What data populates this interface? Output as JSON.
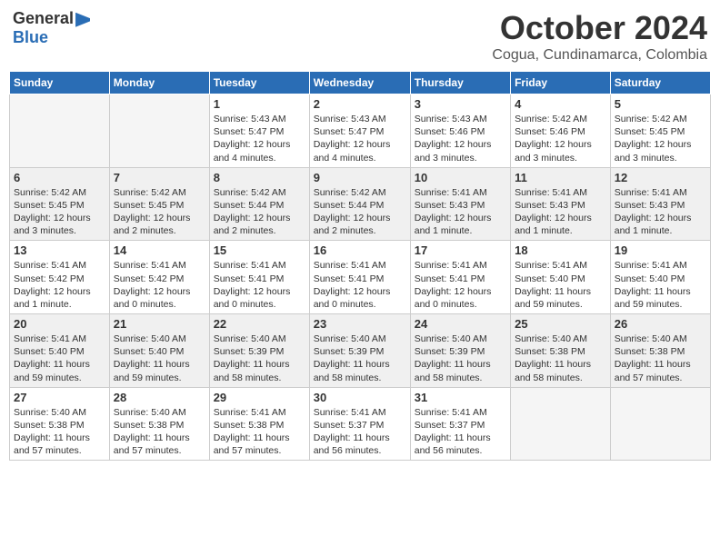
{
  "logo": {
    "general": "General",
    "blue": "Blue"
  },
  "title": "October 2024",
  "location": "Cogua, Cundinamarca, Colombia",
  "weekdays": [
    "Sunday",
    "Monday",
    "Tuesday",
    "Wednesday",
    "Thursday",
    "Friday",
    "Saturday"
  ],
  "weeks": [
    [
      {
        "day": "",
        "info": ""
      },
      {
        "day": "",
        "info": ""
      },
      {
        "day": "1",
        "info": "Sunrise: 5:43 AM\nSunset: 5:47 PM\nDaylight: 12 hours and 4 minutes."
      },
      {
        "day": "2",
        "info": "Sunrise: 5:43 AM\nSunset: 5:47 PM\nDaylight: 12 hours and 4 minutes."
      },
      {
        "day": "3",
        "info": "Sunrise: 5:43 AM\nSunset: 5:46 PM\nDaylight: 12 hours and 3 minutes."
      },
      {
        "day": "4",
        "info": "Sunrise: 5:42 AM\nSunset: 5:46 PM\nDaylight: 12 hours and 3 minutes."
      },
      {
        "day": "5",
        "info": "Sunrise: 5:42 AM\nSunset: 5:45 PM\nDaylight: 12 hours and 3 minutes."
      }
    ],
    [
      {
        "day": "6",
        "info": "Sunrise: 5:42 AM\nSunset: 5:45 PM\nDaylight: 12 hours and 3 minutes."
      },
      {
        "day": "7",
        "info": "Sunrise: 5:42 AM\nSunset: 5:45 PM\nDaylight: 12 hours and 2 minutes."
      },
      {
        "day": "8",
        "info": "Sunrise: 5:42 AM\nSunset: 5:44 PM\nDaylight: 12 hours and 2 minutes."
      },
      {
        "day": "9",
        "info": "Sunrise: 5:42 AM\nSunset: 5:44 PM\nDaylight: 12 hours and 2 minutes."
      },
      {
        "day": "10",
        "info": "Sunrise: 5:41 AM\nSunset: 5:43 PM\nDaylight: 12 hours and 1 minute."
      },
      {
        "day": "11",
        "info": "Sunrise: 5:41 AM\nSunset: 5:43 PM\nDaylight: 12 hours and 1 minute."
      },
      {
        "day": "12",
        "info": "Sunrise: 5:41 AM\nSunset: 5:43 PM\nDaylight: 12 hours and 1 minute."
      }
    ],
    [
      {
        "day": "13",
        "info": "Sunrise: 5:41 AM\nSunset: 5:42 PM\nDaylight: 12 hours and 1 minute."
      },
      {
        "day": "14",
        "info": "Sunrise: 5:41 AM\nSunset: 5:42 PM\nDaylight: 12 hours and 0 minutes."
      },
      {
        "day": "15",
        "info": "Sunrise: 5:41 AM\nSunset: 5:41 PM\nDaylight: 12 hours and 0 minutes."
      },
      {
        "day": "16",
        "info": "Sunrise: 5:41 AM\nSunset: 5:41 PM\nDaylight: 12 hours and 0 minutes."
      },
      {
        "day": "17",
        "info": "Sunrise: 5:41 AM\nSunset: 5:41 PM\nDaylight: 12 hours and 0 minutes."
      },
      {
        "day": "18",
        "info": "Sunrise: 5:41 AM\nSunset: 5:40 PM\nDaylight: 11 hours and 59 minutes."
      },
      {
        "day": "19",
        "info": "Sunrise: 5:41 AM\nSunset: 5:40 PM\nDaylight: 11 hours and 59 minutes."
      }
    ],
    [
      {
        "day": "20",
        "info": "Sunrise: 5:41 AM\nSunset: 5:40 PM\nDaylight: 11 hours and 59 minutes."
      },
      {
        "day": "21",
        "info": "Sunrise: 5:40 AM\nSunset: 5:40 PM\nDaylight: 11 hours and 59 minutes."
      },
      {
        "day": "22",
        "info": "Sunrise: 5:40 AM\nSunset: 5:39 PM\nDaylight: 11 hours and 58 minutes."
      },
      {
        "day": "23",
        "info": "Sunrise: 5:40 AM\nSunset: 5:39 PM\nDaylight: 11 hours and 58 minutes."
      },
      {
        "day": "24",
        "info": "Sunrise: 5:40 AM\nSunset: 5:39 PM\nDaylight: 11 hours and 58 minutes."
      },
      {
        "day": "25",
        "info": "Sunrise: 5:40 AM\nSunset: 5:38 PM\nDaylight: 11 hours and 58 minutes."
      },
      {
        "day": "26",
        "info": "Sunrise: 5:40 AM\nSunset: 5:38 PM\nDaylight: 11 hours and 57 minutes."
      }
    ],
    [
      {
        "day": "27",
        "info": "Sunrise: 5:40 AM\nSunset: 5:38 PM\nDaylight: 11 hours and 57 minutes."
      },
      {
        "day": "28",
        "info": "Sunrise: 5:40 AM\nSunset: 5:38 PM\nDaylight: 11 hours and 57 minutes."
      },
      {
        "day": "29",
        "info": "Sunrise: 5:41 AM\nSunset: 5:38 PM\nDaylight: 11 hours and 57 minutes."
      },
      {
        "day": "30",
        "info": "Sunrise: 5:41 AM\nSunset: 5:37 PM\nDaylight: 11 hours and 56 minutes."
      },
      {
        "day": "31",
        "info": "Sunrise: 5:41 AM\nSunset: 5:37 PM\nDaylight: 11 hours and 56 minutes."
      },
      {
        "day": "",
        "info": ""
      },
      {
        "day": "",
        "info": ""
      }
    ]
  ]
}
